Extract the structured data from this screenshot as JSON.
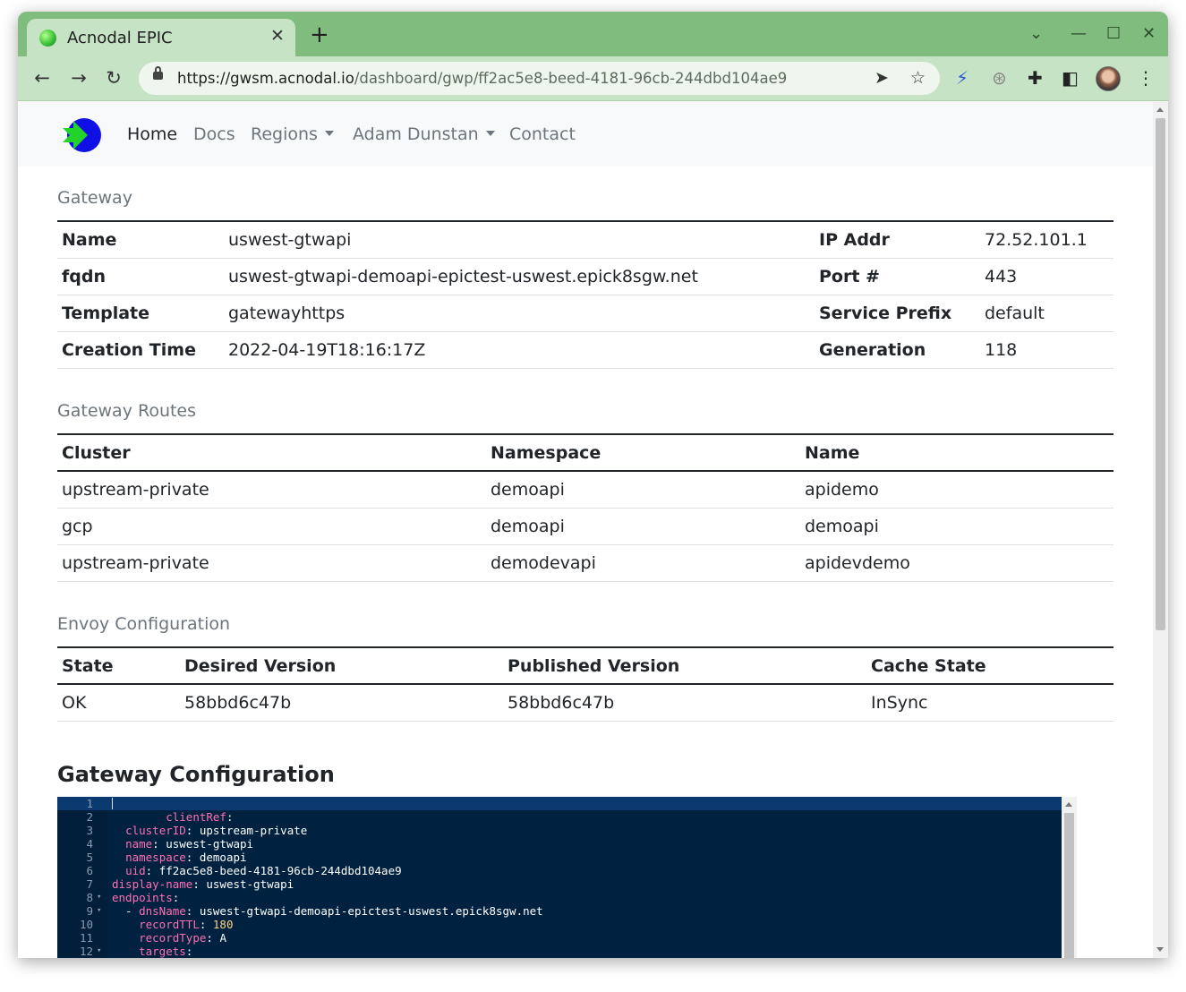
{
  "browser": {
    "tab_title": "Acnodal EPIC",
    "tab_close": "✕",
    "new_tab": "+",
    "url_host": "https://gwsm.acnodal.io",
    "url_path": "/dashboard/gwp/ff2ac5e8-beed-4181-96cb-244dbd104ae9"
  },
  "navbar": {
    "links": [
      "Home",
      "Docs",
      "Regions",
      "Adam Dunstan",
      "Contact"
    ]
  },
  "gateway": {
    "title": "Gateway",
    "rows": [
      {
        "label": "Name",
        "value": "uswest-gtwapi",
        "label2": "IP Addr",
        "value2": "72.52.101.1"
      },
      {
        "label": "fqdn",
        "value": "uswest-gtwapi-demoapi-epictest-uswest.epick8sgw.net",
        "label2": "Port #",
        "value2": "443"
      },
      {
        "label": "Template",
        "value": "gatewayhttps",
        "label2": "Service Prefix",
        "value2": "default"
      },
      {
        "label": "Creation Time",
        "value": "2022-04-19T18:16:17Z",
        "label2": "Generation",
        "value2": "118"
      }
    ]
  },
  "routes": {
    "title": "Gateway Routes",
    "headers": [
      "Cluster",
      "Namespace",
      "Name"
    ],
    "rows": [
      [
        "upstream-private",
        "demoapi",
        "apidemo"
      ],
      [
        "gcp",
        "demoapi",
        "demoapi"
      ],
      [
        "upstream-private",
        "demodevapi",
        "apidevdemo"
      ]
    ]
  },
  "envoy": {
    "title": "Envoy Configuration",
    "headers": [
      "State",
      "Desired Version",
      "Published Version",
      "Cache State"
    ],
    "rows": [
      [
        "OK",
        "58bbd6c47b",
        "58bbd6c47b",
        "InSync"
      ]
    ]
  },
  "config": {
    "title": "Gateway Configuration",
    "lines": [
      {
        "n": "1",
        "fold": "",
        "indent": "",
        "key": "",
        "value": ""
      },
      {
        "n": "2",
        "fold": "",
        "indent": "        ",
        "key": "clientRef",
        "value": ""
      },
      {
        "n": "3",
        "fold": "",
        "indent": "  ",
        "key": "clusterID",
        "value": "upstream-private"
      },
      {
        "n": "4",
        "fold": "",
        "indent": "  ",
        "key": "name",
        "value": "uswest-gtwapi"
      },
      {
        "n": "5",
        "fold": "",
        "indent": "  ",
        "key": "namespace",
        "value": "demoapi"
      },
      {
        "n": "6",
        "fold": "",
        "indent": "  ",
        "key": "uid",
        "value": "ff2ac5e8-beed-4181-96cb-244dbd104ae9"
      },
      {
        "n": "7",
        "fold": "",
        "indent": "",
        "key": "display-name",
        "value": "uswest-gtwapi"
      },
      {
        "n": "8",
        "fold": "▾",
        "indent": "",
        "key": "endpoints",
        "value": ""
      },
      {
        "n": "9",
        "fold": "▾",
        "indent": "  - ",
        "key": "dnsName",
        "value": "uswest-gtwapi-demoapi-epictest-uswest.epick8sgw.net"
      },
      {
        "n": "10",
        "fold": "",
        "indent": "    ",
        "key": "recordTTL",
        "value": "180",
        "numeric": true
      },
      {
        "n": "11",
        "fold": "",
        "indent": "    ",
        "key": "recordType",
        "value": "A"
      },
      {
        "n": "12",
        "fold": "▾",
        "indent": "    ",
        "key": "targets",
        "value": ""
      }
    ]
  }
}
